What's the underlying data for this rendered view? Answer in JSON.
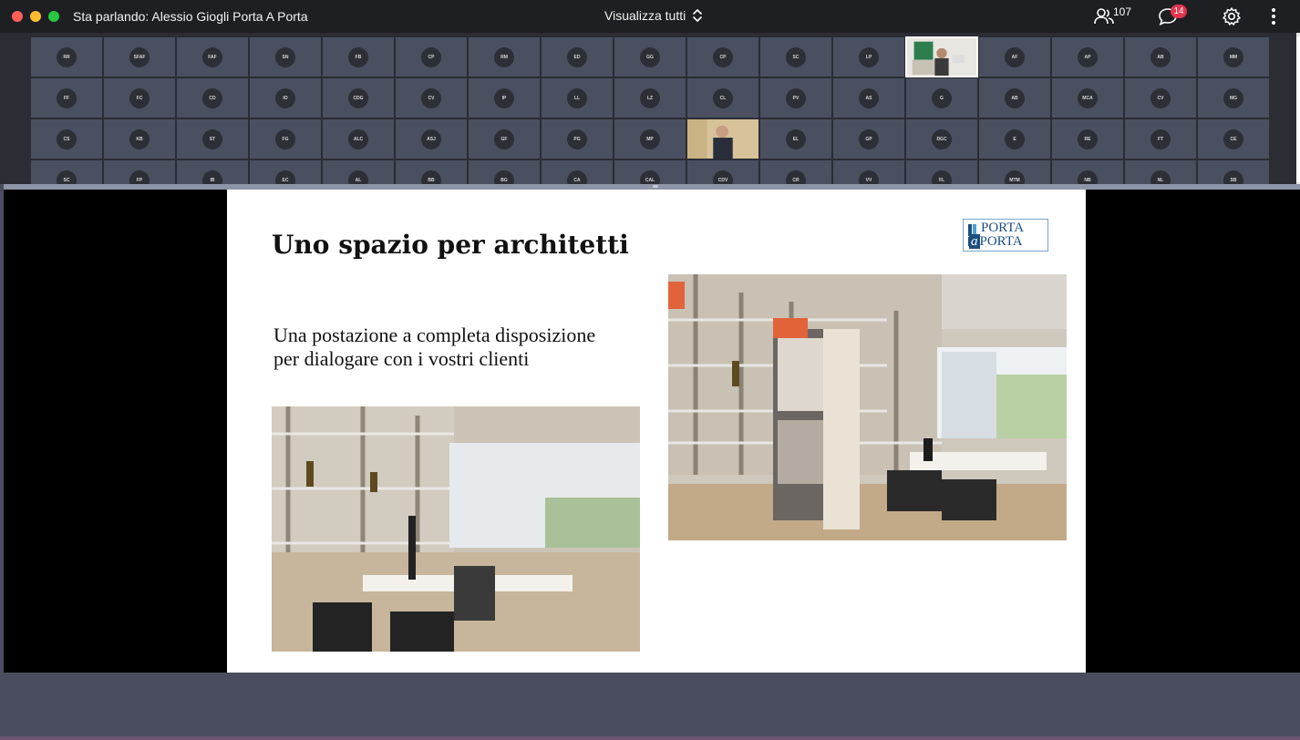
{
  "topbar": {
    "speaker_label": "Sta parlando: Alessio Giogli Porta A Porta",
    "view_label": "Visualizza tutti",
    "participants_count": "107",
    "chat_badge": "14"
  },
  "gallery": {
    "rows": [
      [
        "RR",
        "SFAF",
        "FAF",
        "SN",
        "FB",
        "CP",
        "RM",
        "ED",
        "GG",
        "CP",
        "SC",
        "LP",
        "__VIDEO_A__",
        "AF",
        "AP",
        "AB",
        "MM"
      ],
      [
        "FF",
        "FC",
        "CD",
        "IO",
        "CDG",
        "CV",
        "IP",
        "LL",
        "LZ",
        "CL",
        "PV",
        "AS",
        "G",
        "AB",
        "MCA",
        "CV",
        "MG"
      ],
      [
        "CS",
        "KB",
        "ST",
        "FG",
        "ALC",
        "ASJ",
        "GF",
        "PG",
        "MP",
        "__VIDEO_B__",
        "EL",
        "GP",
        "DGC",
        "E",
        "RE",
        "FT",
        "CE"
      ],
      [
        "SC",
        "FP",
        "IB",
        "EC",
        "AL",
        "BB",
        "BG",
        "CA",
        "CAL",
        "CDV",
        "CR",
        "VV",
        "FL",
        "MTM",
        "NB",
        "NL",
        "SB"
      ]
    ]
  },
  "slide": {
    "title": "Uno spazio per architetti",
    "body_line1": "Una postazione a completa disposizione",
    "body_line2": "per dialogare con i vostri clienti",
    "logo_line1": "PORTA",
    "logo_line2_a": "a",
    "logo_line2_b": "PORTA"
  },
  "colors": {
    "topbar_bg": "#1e1f23",
    "tile_bg": "#4a5060",
    "chat_badge": "#e2344e",
    "logo_blue": "#1c4f7f"
  }
}
